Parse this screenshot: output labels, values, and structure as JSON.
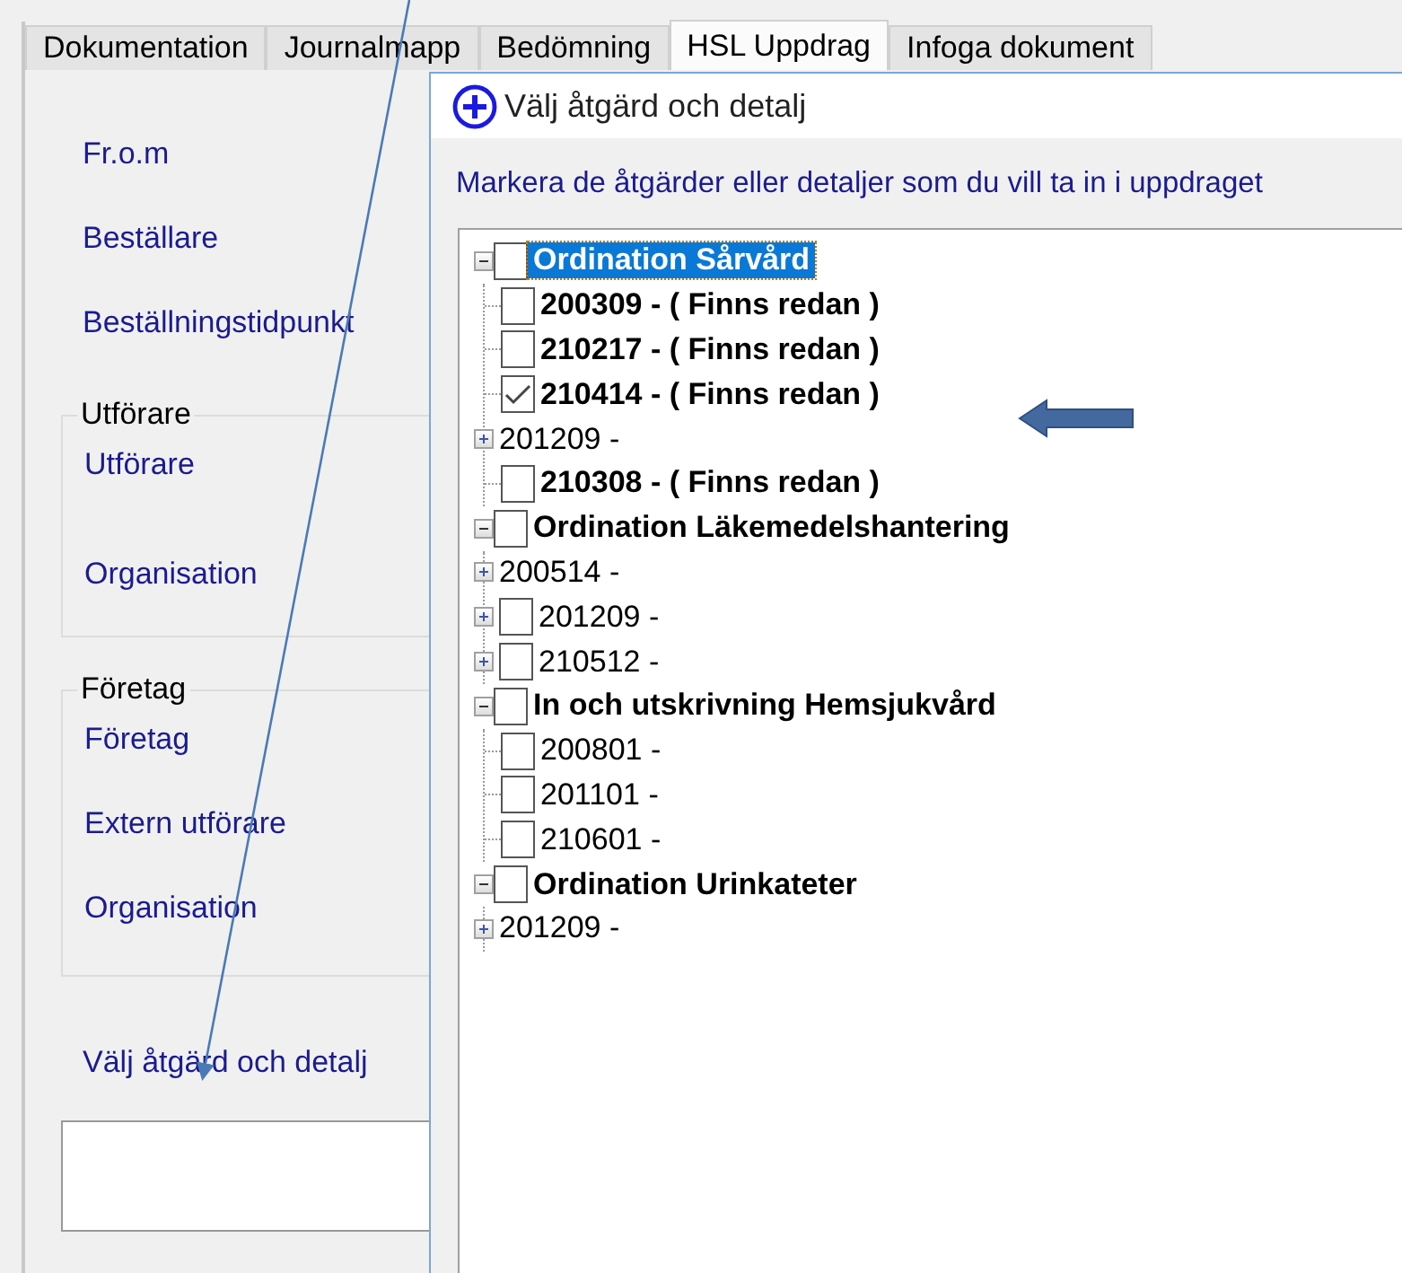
{
  "tabs": [
    {
      "label": "Dokumentation",
      "selected": false
    },
    {
      "label": "Journalmapp",
      "selected": false
    },
    {
      "label": "Bedömning",
      "selected": false
    },
    {
      "label": "HSL Uppdrag",
      "selected": true
    },
    {
      "label": "Infoga dokument",
      "selected": false
    }
  ],
  "form": {
    "fields": [
      "Fr.o.m",
      "Beställare",
      "Beställningstidpunkt"
    ],
    "groups": [
      {
        "legend": "Utförare",
        "fields": [
          "Utförare",
          "Organisation"
        ]
      },
      {
        "legend": "Företag",
        "fields": [
          "Företag",
          "Extern utförare",
          "Organisation"
        ]
      }
    ],
    "link": "Välj åtgärd och detalj"
  },
  "dialog": {
    "title": "Välj åtgärd och detalj",
    "instruction": "Markera de åtgärder eller detaljer som du vill ta in i uppdraget",
    "tree": [
      {
        "label": "Ordination Sårvård",
        "expanded": true,
        "checked": false,
        "selected": true,
        "children": [
          {
            "label": "200309 - ( Finns redan )",
            "expandable": false,
            "checkbox": true,
            "checked": false,
            "bold": true
          },
          {
            "label": "210217 - ( Finns redan )",
            "expandable": false,
            "checkbox": true,
            "checked": false,
            "bold": true
          },
          {
            "label": "210414 - ( Finns redan )",
            "expandable": false,
            "checkbox": true,
            "checked": true,
            "bold": true
          },
          {
            "label": "201209 -",
            "expandable": true,
            "checkbox": false,
            "bold": false
          },
          {
            "label": "210308 - ( Finns redan )",
            "expandable": false,
            "checkbox": true,
            "checked": false,
            "bold": true
          }
        ]
      },
      {
        "label": "Ordination Läkemedelshantering",
        "expanded": true,
        "checked": false,
        "selected": false,
        "children": [
          {
            "label": "200514 -",
            "expandable": true,
            "checkbox": false,
            "bold": false
          },
          {
            "label": "201209 -",
            "expandable": true,
            "checkbox": true,
            "checked": false,
            "bold": false
          },
          {
            "label": "210512 -",
            "expandable": true,
            "checkbox": true,
            "checked": false,
            "bold": false
          }
        ]
      },
      {
        "label": "In och utskrivning Hemsjukvård",
        "expanded": true,
        "checked": false,
        "selected": false,
        "children": [
          {
            "label": "200801 -",
            "expandable": false,
            "checkbox": true,
            "checked": false,
            "bold": false
          },
          {
            "label": "201101 -",
            "expandable": false,
            "checkbox": true,
            "checked": false,
            "bold": false
          },
          {
            "label": "210601 -",
            "expandable": false,
            "checkbox": true,
            "checked": false,
            "bold": false
          }
        ]
      },
      {
        "label": "Ordination Urinkateter",
        "expanded": true,
        "checked": false,
        "selected": false,
        "children": [
          {
            "label": "201209 -",
            "expandable": true,
            "checkbox": false,
            "bold": false
          }
        ]
      }
    ]
  }
}
